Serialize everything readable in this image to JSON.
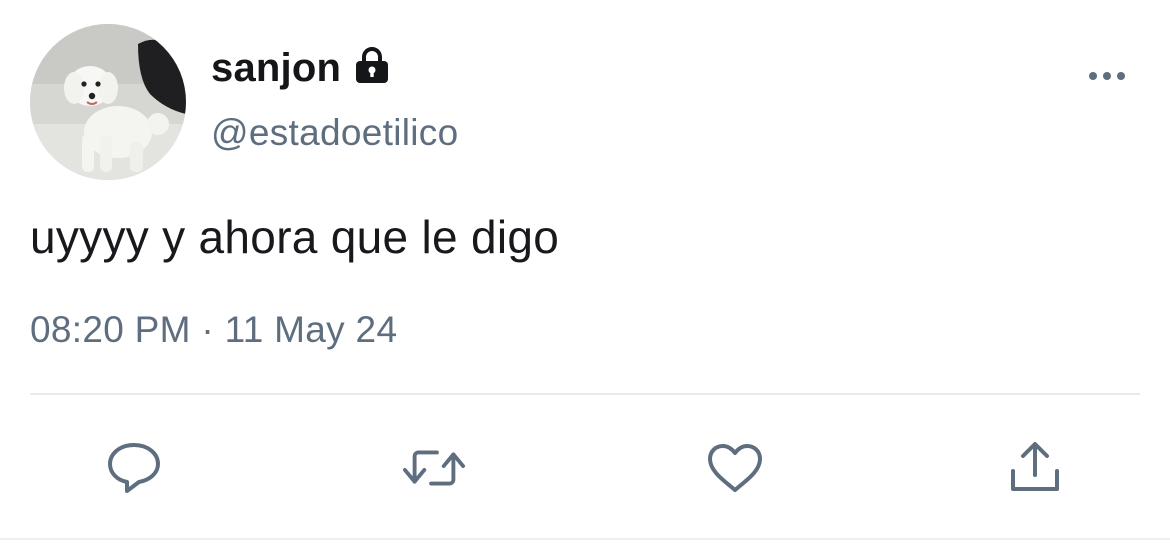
{
  "user": {
    "display_name": "sanjon",
    "handle": "@estadoetilico",
    "protected_icon": "lock-icon",
    "avatar": "white poodle photo"
  },
  "tweet": {
    "text": "uyyyy y ahora que le digo",
    "time": "08:20 PM",
    "separator": "·",
    "date": "11 May 24"
  },
  "actions": [
    {
      "name": "reply",
      "icon": "reply-icon"
    },
    {
      "name": "retweet",
      "icon": "retweet-icon"
    },
    {
      "name": "like",
      "icon": "heart-icon"
    },
    {
      "name": "share",
      "icon": "share-icon"
    }
  ],
  "more_icon": "more-icon",
  "colors": {
    "text": "#17191c",
    "secondary": "#5e6e7e",
    "divider": "#e6eaed"
  }
}
